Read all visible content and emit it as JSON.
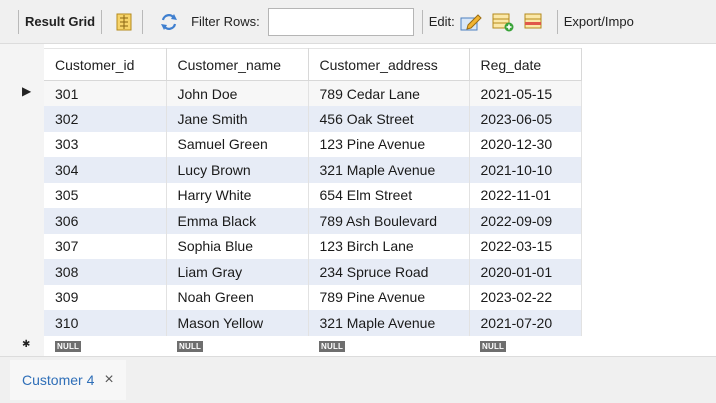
{
  "toolbar": {
    "result_grid_label": "Result Grid",
    "filter_rows_label": "Filter Rows:",
    "filter_value": "",
    "edit_label": "Edit:",
    "export_label": "Export/Impo"
  },
  "grid": {
    "columns": [
      "Customer_id",
      "Customer_name",
      "Customer_address",
      "Reg_date"
    ],
    "rows": [
      [
        "301",
        "John Doe",
        "789 Cedar Lane",
        "2021-05-15"
      ],
      [
        "302",
        "Jane Smith",
        "456 Oak Street",
        "2023-06-05"
      ],
      [
        "303",
        "Samuel Green",
        "123 Pine Avenue",
        "2020-12-30"
      ],
      [
        "304",
        "Lucy Brown",
        "321 Maple Avenue",
        "2021-10-10"
      ],
      [
        "305",
        "Harry White",
        "654 Elm Street",
        "2022-11-01"
      ],
      [
        "306",
        "Emma Black",
        "789 Ash Boulevard",
        "2022-09-09"
      ],
      [
        "307",
        "Sophia Blue",
        "123 Birch Lane",
        "2022-03-15"
      ],
      [
        "308",
        "Liam Gray",
        "234 Spruce Road",
        "2020-01-01"
      ],
      [
        "309",
        "Noah Green",
        "789 Pine Avenue",
        "2023-02-22"
      ],
      [
        "310",
        "Mason Yellow",
        "321 Maple Avenue",
        "2021-07-20"
      ]
    ],
    "null_label": "NULL",
    "current_row_marker": "▶",
    "new_row_marker": "✱"
  },
  "tabs": [
    {
      "label": "Customer 4",
      "close": "×"
    }
  ],
  "colors": {
    "alt_row": "#e7ecf6",
    "tab_text": "#2f6fb8",
    "null_badge": "#6e6e6e"
  }
}
